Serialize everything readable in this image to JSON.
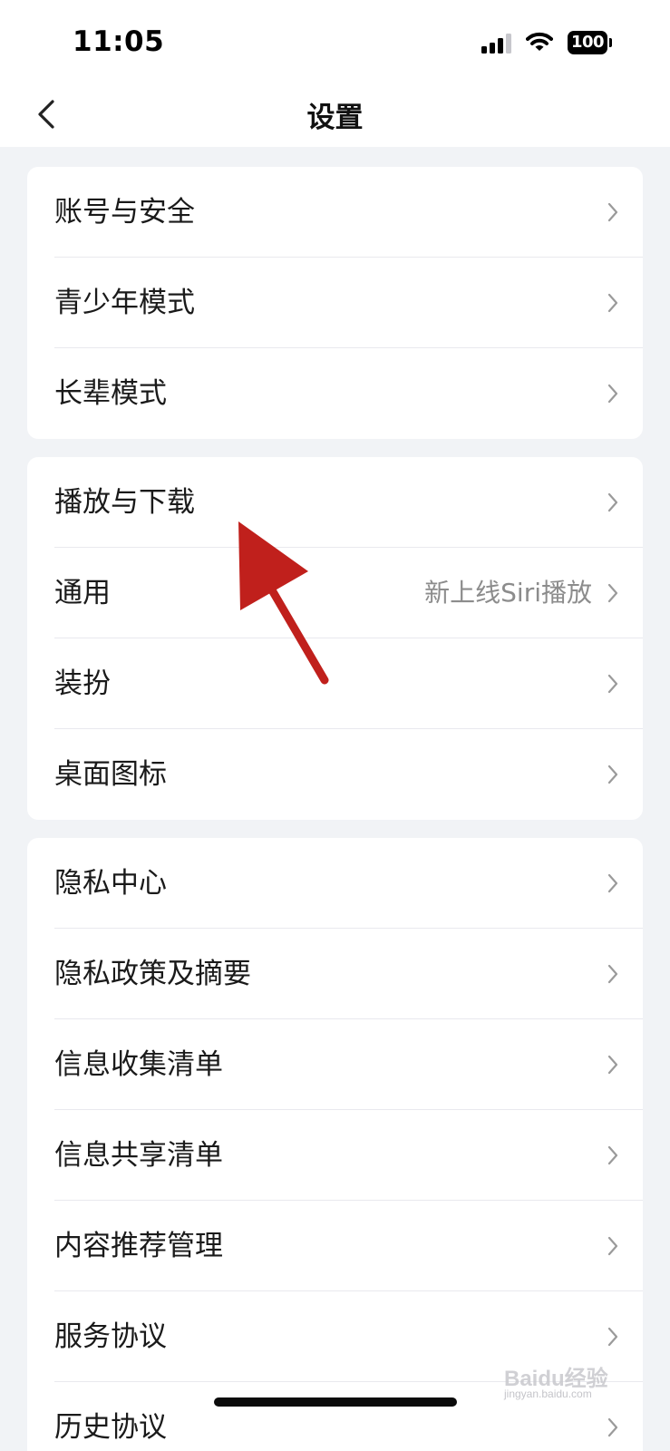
{
  "status_bar": {
    "time": "11:05",
    "battery": "100",
    "icons": [
      "signal-icon",
      "wifi-icon",
      "battery-icon"
    ]
  },
  "nav": {
    "title": "设置",
    "back_icon": "chevron-left-icon"
  },
  "groups": [
    {
      "items": [
        {
          "label": "账号与安全",
          "value": ""
        },
        {
          "label": "青少年模式",
          "value": ""
        },
        {
          "label": "长辈模式",
          "value": ""
        }
      ]
    },
    {
      "items": [
        {
          "label": "播放与下载",
          "value": ""
        },
        {
          "label": "通用",
          "value": "新上线Siri播放"
        },
        {
          "label": "装扮",
          "value": ""
        },
        {
          "label": "桌面图标",
          "value": ""
        }
      ]
    },
    {
      "items": [
        {
          "label": "隐私中心",
          "value": ""
        },
        {
          "label": "隐私政策及摘要",
          "value": ""
        },
        {
          "label": "信息收集清单",
          "value": ""
        },
        {
          "label": "信息共享清单",
          "value": ""
        },
        {
          "label": "内容推荐管理",
          "value": ""
        },
        {
          "label": "服务协议",
          "value": ""
        },
        {
          "label": "历史协议",
          "value": ""
        }
      ]
    }
  ],
  "annotation": {
    "icon": "red-arrow-icon",
    "color": "#c0201c"
  },
  "watermark": {
    "text": "Baidu经验",
    "sub": "jingyan.baidu.com"
  },
  "colors": {
    "background": "#f1f3f6",
    "card": "#ffffff",
    "text": "#1a1a1a",
    "secondary": "#8c8c8c"
  }
}
